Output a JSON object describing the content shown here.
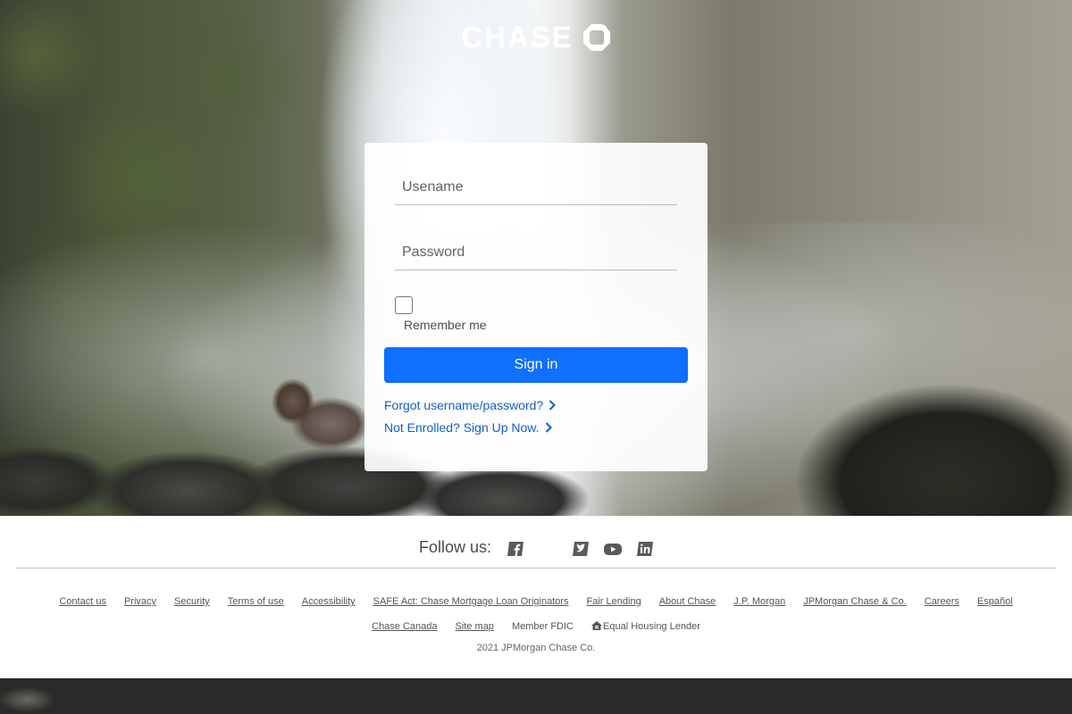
{
  "brand": {
    "logo_text": "CHASE",
    "logo_icon": "chase-octagon-icon",
    "color": "#ffffff"
  },
  "login": {
    "username_placeholder": "Usename",
    "username_value": "",
    "password_placeholder": "Password",
    "password_value": "",
    "remember_label": "Remember me",
    "remember_checked": false,
    "signin_label": "Sign in",
    "signin_color": "#0f6fff",
    "forgot_link": "Forgot username/password?",
    "enroll_link": "Not Enrolled? Sign Up Now.",
    "link_color": "#1260c9"
  },
  "footer": {
    "follow_label": "Follow us:",
    "social_icons": [
      "facebook-icon",
      "twitter-icon",
      "youtube-icon",
      "linkedin-icon"
    ],
    "links_row1": [
      "Contact us",
      "Privacy",
      "Security",
      "Terms of use",
      "Accessibility",
      "SAFE Act: Chase Mortgage Loan Originators",
      "Fair Lending",
      "About Chase",
      "J.P. Morgan",
      "JPMorgan Chase & Co.",
      "Careers",
      "Español"
    ],
    "links_row2": {
      "chase_canada": "Chase Canada",
      "site_map": "Site map",
      "member_fdic": "Member FDIC",
      "equal_housing": "Equal Housing Lender"
    },
    "copyright": "2021 JPMorgan Chase Co."
  }
}
